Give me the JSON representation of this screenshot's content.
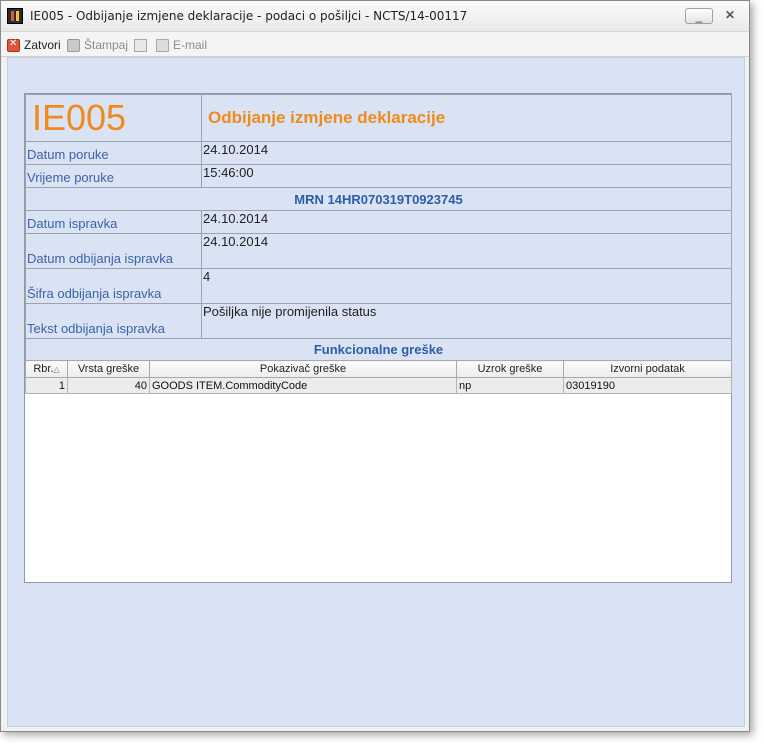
{
  "window": {
    "title": "IE005 - Odbijanje izmjene deklaracije - podaci o pošiljci - NCTS/14-00117",
    "minimize_label": "_",
    "close_label": "✕"
  },
  "toolbar": {
    "close_label": "Zatvori",
    "print_label": "Štampaj",
    "email_label": "E-mail"
  },
  "header": {
    "code": "IE005",
    "subtitle": "Odbijanje izmjene deklaracije"
  },
  "fields": {
    "datum_poruke_label": "Datum poruke",
    "datum_poruke_value": "24.10.2014",
    "vrijeme_poruke_label": "Vrijeme poruke",
    "vrijeme_poruke_value": "15:46:00",
    "mrn": "MRN 14HR070319T0923745",
    "datum_ispravka_label": "Datum ispravka",
    "datum_ispravka_value": "24.10.2014",
    "datum_odbijanja_label": "Datum odbijanja ispravka",
    "datum_odbijanja_value": "24.10.2014",
    "sifra_odbijanja_label": "Šifra odbijanja ispravka",
    "sifra_odbijanja_value": "4",
    "tekst_odbijanja_label": "Tekst odbijanja ispravka",
    "tekst_odbijanja_value": "Pošiljka nije promijenila status",
    "funkcionalne_title": "Funkcionalne greške"
  },
  "errors_table": {
    "columns": [
      "Rbr.",
      "Vrsta greške",
      "Pokazivač greške",
      "Uzrok greške",
      "Izvorni podatak"
    ],
    "sort_indicator": "△",
    "rows": [
      [
        "1",
        "40",
        "GOODS ITEM.CommodityCode",
        "np",
        "03019190"
      ]
    ]
  }
}
